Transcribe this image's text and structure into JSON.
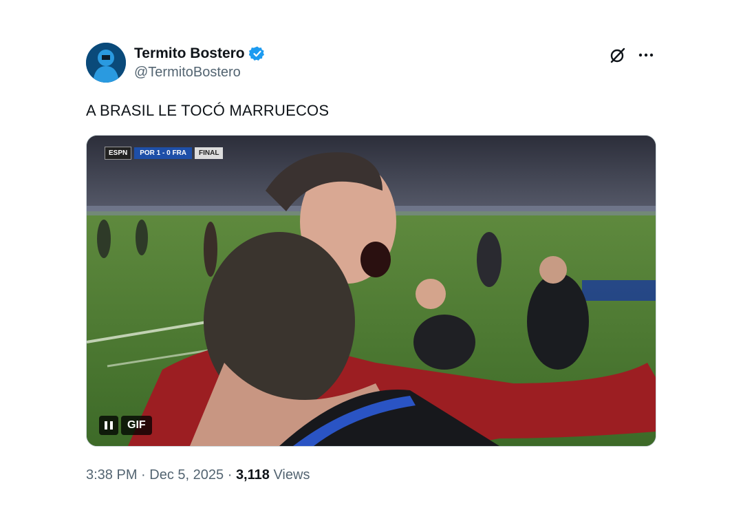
{
  "user": {
    "display_name": "Termito Bostero",
    "handle": "@TermitoBostero",
    "verified": true,
    "verified_color": "#1d9bf0"
  },
  "header_icons": [
    "grok-icon",
    "more-icon"
  ],
  "tweet": {
    "text": "A BRASIL LE TOCÓ MARRUECOS"
  },
  "media": {
    "type": "gif",
    "badge": "GIF",
    "scorebug": {
      "network": "ESPN",
      "teams_score": "POR 1 - 0 FRA",
      "status": "FINAL"
    }
  },
  "meta": {
    "time": "3:38 PM",
    "separator": "·",
    "date": "Dec 5, 2025",
    "views_count": "3,118",
    "views_label": "Views"
  }
}
